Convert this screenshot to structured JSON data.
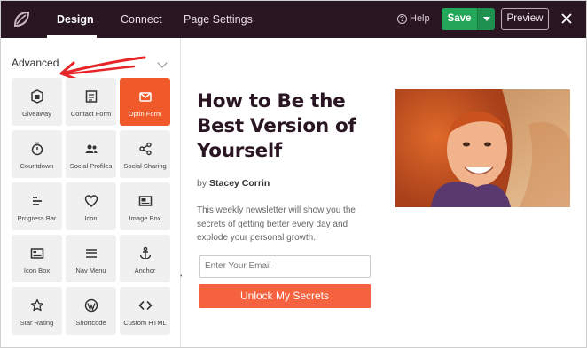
{
  "topbar": {
    "tabs": [
      {
        "label": "Design",
        "active": true
      },
      {
        "label": "Connect",
        "active": false
      },
      {
        "label": "Page Settings",
        "active": false
      }
    ],
    "help_label": "Help",
    "save_label": "Save",
    "preview_label": "Preview",
    "icons": {
      "logo": "seedprod-leaf-logo",
      "close": "close-icon",
      "help": "question-circle-icon"
    },
    "colors": {
      "bar": "#2a1622",
      "save": "#23a55a"
    }
  },
  "sidebar": {
    "section_title": "Advanced",
    "blocks": [
      {
        "label": "Giveaway",
        "icon": "giveaway-icon",
        "active": false
      },
      {
        "label": "Contact Form",
        "icon": "contact-form-icon",
        "active": false
      },
      {
        "label": "Optin Form",
        "icon": "optin-form-icon",
        "active": true
      },
      {
        "label": "Countdown",
        "icon": "countdown-icon",
        "active": false
      },
      {
        "label": "Social Profiles",
        "icon": "social-profiles-icon",
        "active": false
      },
      {
        "label": "Social Sharing",
        "icon": "share-icon",
        "active": false
      },
      {
        "label": "Progress Bar",
        "icon": "progress-bar-icon",
        "active": false
      },
      {
        "label": "Icon",
        "icon": "heart-icon",
        "active": false
      },
      {
        "label": "Image Box",
        "icon": "image-box-icon",
        "active": false
      },
      {
        "label": "Icon Box",
        "icon": "icon-box-icon",
        "active": false
      },
      {
        "label": "Nav Menu",
        "icon": "menu-icon",
        "active": false
      },
      {
        "label": "Anchor",
        "icon": "anchor-icon",
        "active": false
      },
      {
        "label": "Star Rating",
        "icon": "star-icon",
        "active": false
      },
      {
        "label": "Shortcode",
        "icon": "wordpress-icon",
        "active": false
      },
      {
        "label": "Custom HTML",
        "icon": "code-icon",
        "active": false
      }
    ],
    "accent": "#f05a2a"
  },
  "main": {
    "headline": "How to Be the Best Version of Yourself",
    "byline_prefix": "by",
    "author": "Stacey Corrin",
    "description": "This weekly newsletter will show you the secrets of getting better every day and explode your personal growth.",
    "email_placeholder": "Enter Your Email",
    "cta_label": "Unlock My Secrets",
    "cta_color": "#f4623f"
  }
}
